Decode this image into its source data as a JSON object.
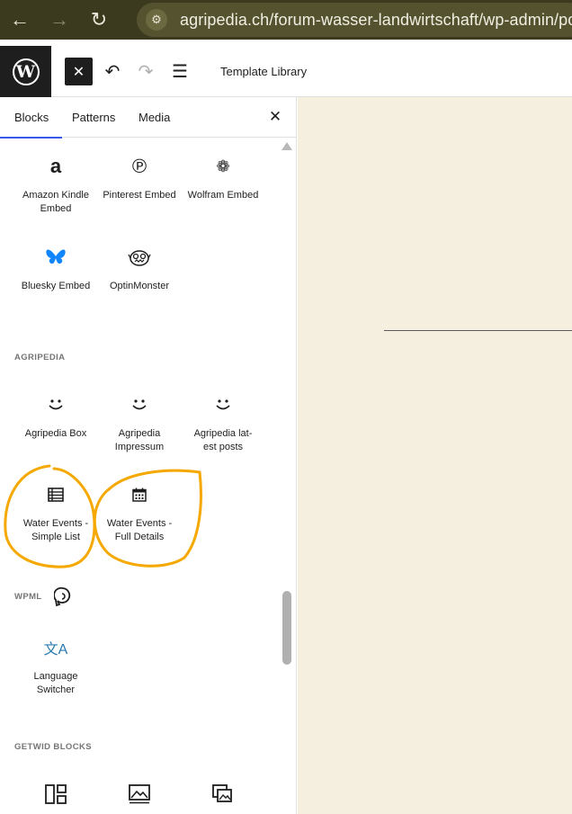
{
  "browser": {
    "url": "agripedia.ch/forum-wasser-landwirtschaft/wp-admin/pos",
    "back_icon": "back-arrow-icon",
    "forward_icon": "forward-arrow-icon",
    "reload_icon": "reload-icon",
    "site_info_icon": "tune-icon"
  },
  "toolbar": {
    "title": "Template Library",
    "close_label": "✕",
    "undo_label": "↶",
    "redo_label": "↷",
    "outline_label": "☰",
    "logo_label": "W"
  },
  "inserter": {
    "tabs": [
      {
        "label": "Blocks",
        "active": true
      },
      {
        "label": "Patterns",
        "active": false
      },
      {
        "label": "Media",
        "active": false
      }
    ],
    "close_label": "✕",
    "embeds": [
      {
        "label": "Amazon Kindle Embed",
        "icon": "amazon-icon",
        "glyph": "a"
      },
      {
        "label": "Pinterest Embed",
        "icon": "pinterest-icon",
        "glyph": "℗"
      },
      {
        "label": "Wolfram Embed",
        "icon": "wolfram-icon",
        "glyph": "❁"
      },
      {
        "label": "Bluesky Embed",
        "icon": "bluesky-butterfly-icon",
        "glyph": "🦋"
      },
      {
        "label": "OptinMonster",
        "icon": "optinmonster-icon",
        "glyph": "👾"
      }
    ],
    "categories": {
      "agripedia": "AGRIPEDIA",
      "wpml": "WPML",
      "getwid": "GETWID BLOCKS"
    },
    "agripedia_blocks": [
      {
        "label": "Agripedia Box",
        "icon": "smiley-icon",
        "glyph": "◡̈"
      },
      {
        "label": "Agripedia Impressum",
        "icon": "smiley-icon",
        "glyph": "◡̈"
      },
      {
        "label": "Agripedia lat-est posts",
        "icon": "smiley-icon",
        "glyph": "◡̈"
      },
      {
        "label": "Water Events - Simple List",
        "icon": "list-table-icon",
        "glyph": "☷"
      },
      {
        "label": "Water Events - Full Details",
        "icon": "calendar-icon",
        "glyph": "▦"
      }
    ],
    "wpml_blocks": [
      {
        "label": "Language Switcher",
        "icon": "translate-icon",
        "glyph": "文A"
      }
    ],
    "getwid_blocks": [
      {
        "label": "",
        "icon": "layout-icon",
        "glyph": "◫"
      },
      {
        "label": "",
        "icon": "image-icon",
        "glyph": "▧"
      },
      {
        "label": "",
        "icon": "gallery-icon",
        "glyph": "⧉"
      }
    ]
  },
  "colors": {
    "browser_bg": "#3b3a1f",
    "wp_dark": "#1e1e1e",
    "accent": "#3858e9",
    "canvas_bg": "#f5efe0",
    "annotation": "#f5a800"
  }
}
